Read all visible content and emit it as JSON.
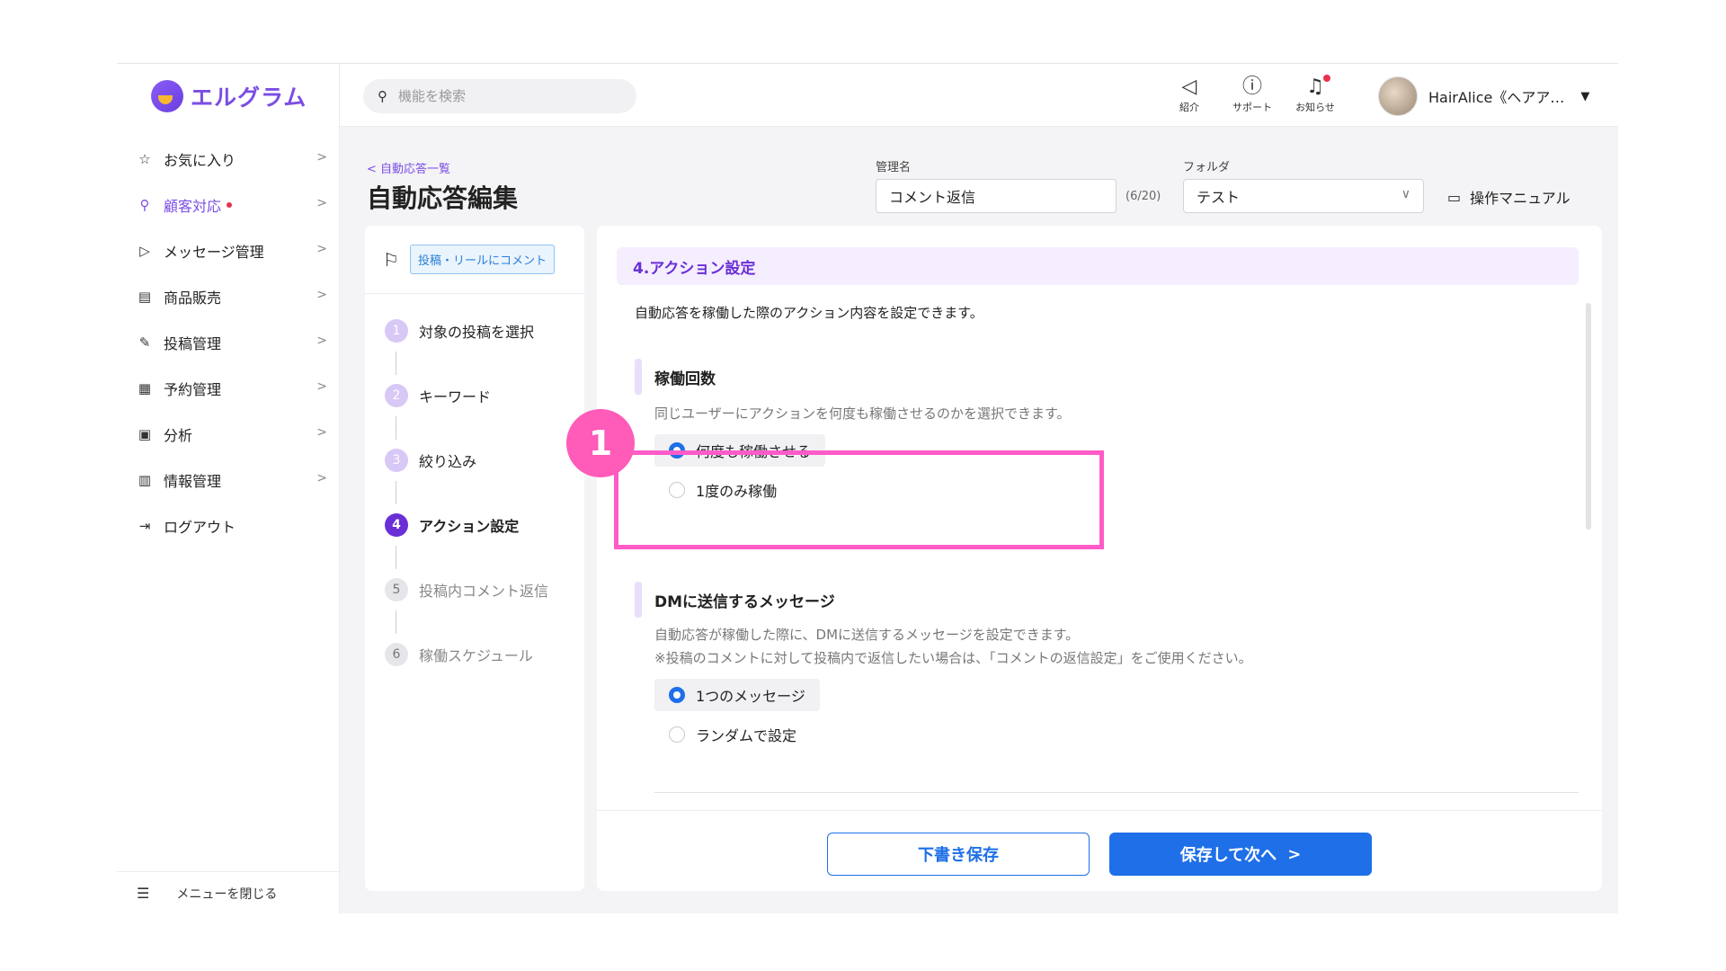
{
  "app": {
    "logo_text": "エルグラム"
  },
  "sidebar": {
    "items": [
      {
        "label": "お気に入り",
        "icon": "star-icon"
      },
      {
        "label": "顧客対応",
        "icon": "person-icon",
        "active": true,
        "dot": true
      },
      {
        "label": "メッセージ管理",
        "icon": "send-icon"
      },
      {
        "label": "商品販売",
        "icon": "store-icon"
      },
      {
        "label": "投稿管理",
        "icon": "edit-icon"
      },
      {
        "label": "予約管理",
        "icon": "calendar-icon"
      },
      {
        "label": "分析",
        "icon": "report-icon"
      },
      {
        "label": "情報管理",
        "icon": "bar-chart-icon"
      },
      {
        "label": "ログアウト",
        "icon": "logout-icon"
      }
    ],
    "close_menu": "メニューを閉じる"
  },
  "header": {
    "search_placeholder": "機能を検索",
    "icons": [
      {
        "label": "紹介",
        "icon": "megaphone-icon"
      },
      {
        "label": "サポート",
        "icon": "help-icon"
      },
      {
        "label": "お知らせ",
        "icon": "bell-icon",
        "badge": true
      }
    ],
    "user_name": "HairAlice《ヘアア…"
  },
  "page": {
    "back_link": "自動応答一覧",
    "title": "自動応答編集",
    "name_label": "管理名",
    "name_value": "コメント返信",
    "name_counter": "(6/20)",
    "folder_label": "フォルダ",
    "folder_value": "テスト",
    "manual_label": "操作マニュアル"
  },
  "steps": {
    "trigger_tag": "投稿・リールにコメント",
    "items": [
      {
        "num": "1",
        "label": "対象の投稿を選択",
        "state": "done"
      },
      {
        "num": "2",
        "label": "キーワード",
        "state": "done"
      },
      {
        "num": "3",
        "label": "絞り込み",
        "state": "done"
      },
      {
        "num": "4",
        "label": "アクション設定",
        "state": "current"
      },
      {
        "num": "5",
        "label": "投稿内コメント返信",
        "state": "pending"
      },
      {
        "num": "6",
        "label": "稼働スケジュール",
        "state": "pending"
      }
    ]
  },
  "content": {
    "section_title": "4.アクション設定",
    "section_desc": "自動応答を稼働した際のアクション内容を設定できます。",
    "run_count": {
      "title": "稼働回数",
      "note": "同じユーザーにアクションを何度も稼働させるのかを選択できます。",
      "options": [
        "何度も稼働させる",
        "1度のみ稼働"
      ],
      "selected": 0
    },
    "dm": {
      "title": "DMに送信するメッセージ",
      "note1": "自動応答が稼働した際に、DMに送信するメッセージを設定できます。",
      "note2": "※投稿のコメントに対して投稿内で返信したい場合は、「コメントの返信設定」をご使用ください。",
      "options": [
        "1つのメッセージ",
        "ランダムで設定"
      ],
      "selected": 0
    },
    "buttons": {
      "draft": "下書き保存",
      "next": "保存して次へ"
    }
  },
  "annotation": {
    "number": "1",
    "color": "#ff5bc8"
  },
  "colors": {
    "accent": "#7b4de3",
    "primary": "#1e6fe8",
    "badge": "#e8314d"
  }
}
